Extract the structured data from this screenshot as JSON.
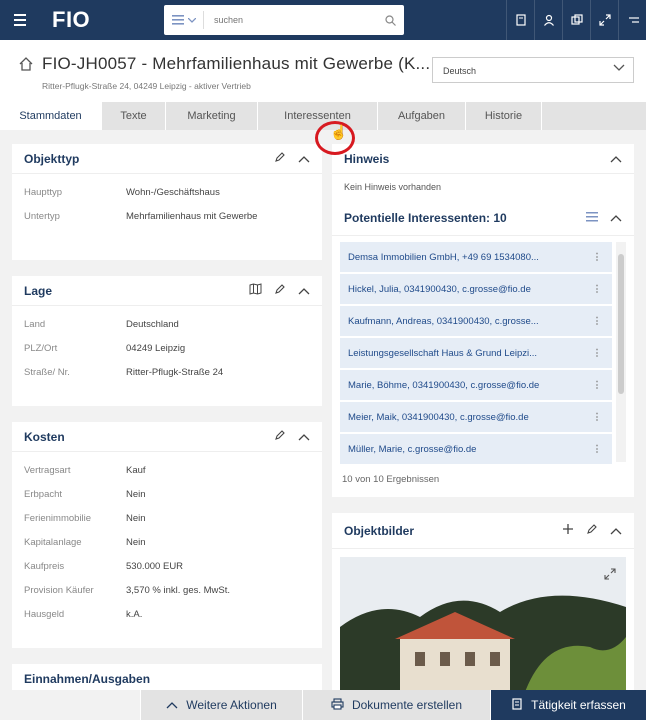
{
  "app": {
    "logo": "FIO"
  },
  "search": {
    "placeholder": "suchen"
  },
  "header": {
    "title": "FIO-JH0057 - Mehrfamilienhaus mit Gewerbe (K...",
    "subtitle": "Ritter-Pflugk-Straße 24, 04249 Leipzig - aktiver Vertrieb",
    "language": "Deutsch"
  },
  "tabs": [
    {
      "label": "Stammdaten",
      "active": true
    },
    {
      "label": "Texte"
    },
    {
      "label": "Marketing"
    },
    {
      "label": "Interessenten"
    },
    {
      "label": "Aufgaben"
    },
    {
      "label": "Historie"
    }
  ],
  "objekttyp": {
    "title": "Objekttyp",
    "rows": [
      {
        "label": "Haupttyp",
        "value": "Wohn-/Geschäftshaus"
      },
      {
        "label": "Untertyp",
        "value": "Mehrfamilienhaus mit Gewerbe"
      }
    ]
  },
  "lage": {
    "title": "Lage",
    "rows": [
      {
        "label": "Land",
        "value": "Deutschland"
      },
      {
        "label": "PLZ/Ort",
        "value": "04249 Leipzig"
      },
      {
        "label": "Straße/ Nr.",
        "value": "Ritter-Pflugk-Straße 24"
      }
    ]
  },
  "kosten": {
    "title": "Kosten",
    "rows": [
      {
        "label": "Vertragsart",
        "value": "Kauf"
      },
      {
        "label": "Erbpacht",
        "value": "Nein"
      },
      {
        "label": "Ferienimmobilie",
        "value": "Nein"
      },
      {
        "label": "Kapitalanlage",
        "value": "Nein"
      },
      {
        "label": "Kaufpreis",
        "value": "530.000 EUR"
      },
      {
        "label": "Provision Käufer",
        "value": "3,570 % inkl. ges. MwSt."
      },
      {
        "label": "Hausgeld",
        "value": "k.A."
      }
    ]
  },
  "einnahmen": {
    "title": "Einnahmen/Ausgaben"
  },
  "hinweis": {
    "title": "Hinweis",
    "text": "Kein Hinweis vorhanden"
  },
  "interessenten": {
    "title": "Potentielle Interessenten: 10",
    "items": [
      "Demsa Immobilien GmbH, +49 69 1534080...",
      "Hickel, Julia, 0341900430, c.grosse@fio.de",
      "Kaufmann, Andreas, 0341900430, c.grosse...",
      "Leistungsgesellschaft Haus & Grund Leipzi...",
      "Marie, Böhme, 0341900430, c.grosse@fio.de",
      "Meier, Maik, 0341900430, c.grosse@fio.de",
      "Müller, Marie, c.grosse@fio.de"
    ],
    "count_text": "10 von 10 Ergebnissen"
  },
  "objektbilder": {
    "title": "Objektbilder"
  },
  "bottom": {
    "more_actions": "Weitere Aktionen",
    "create_docs": "Dokumente erstellen",
    "log_activity": "Tätigkeit erfassen"
  },
  "colors": {
    "primary": "#1f3a5f",
    "accent": "#1f4a8a",
    "annotation": "#d71920"
  }
}
